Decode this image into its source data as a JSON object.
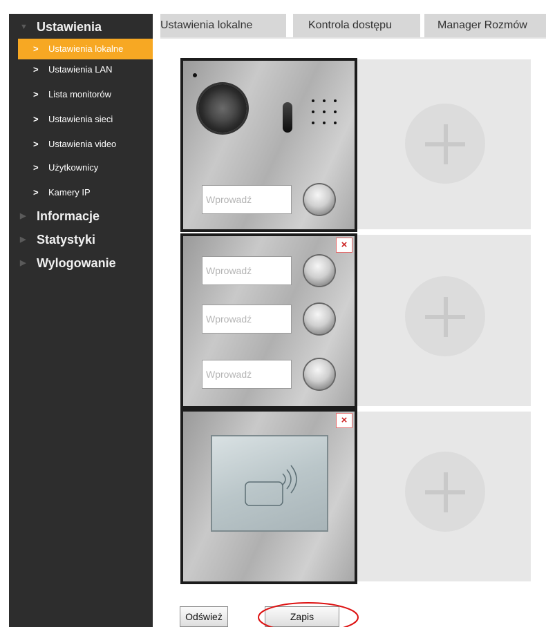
{
  "sidebar": {
    "sections": [
      {
        "label": "Ustawienia"
      },
      {
        "label": "Informacje"
      },
      {
        "label": "Statystyki"
      },
      {
        "label": "Wylogowanie"
      }
    ],
    "items": [
      {
        "label": "Ustawienia lokalne"
      },
      {
        "label": "Ustawienia LAN"
      },
      {
        "label": "Lista monitorów"
      },
      {
        "label": "Ustawienia sieci"
      },
      {
        "label": "Ustawienia video"
      },
      {
        "label": "Użytkownicy"
      },
      {
        "label": "Kamery IP"
      }
    ]
  },
  "tabs": [
    {
      "label": "Ustawienia lokalne"
    },
    {
      "label": "Kontrola dostępu"
    },
    {
      "label": "Manager Rozmów"
    }
  ],
  "modules": {
    "placeholder": "Wprowadź",
    "delete_symbol": "×"
  },
  "icons": {
    "chevron": ">",
    "collapse": "▼",
    "expand": "▶"
  },
  "buttons": {
    "refresh": "Odśwież",
    "save": "Zapis"
  },
  "colors": {
    "sidebar_bg": "#2d2d2d",
    "active_item": "#f7a823",
    "highlight_circle": "#dd1111"
  }
}
